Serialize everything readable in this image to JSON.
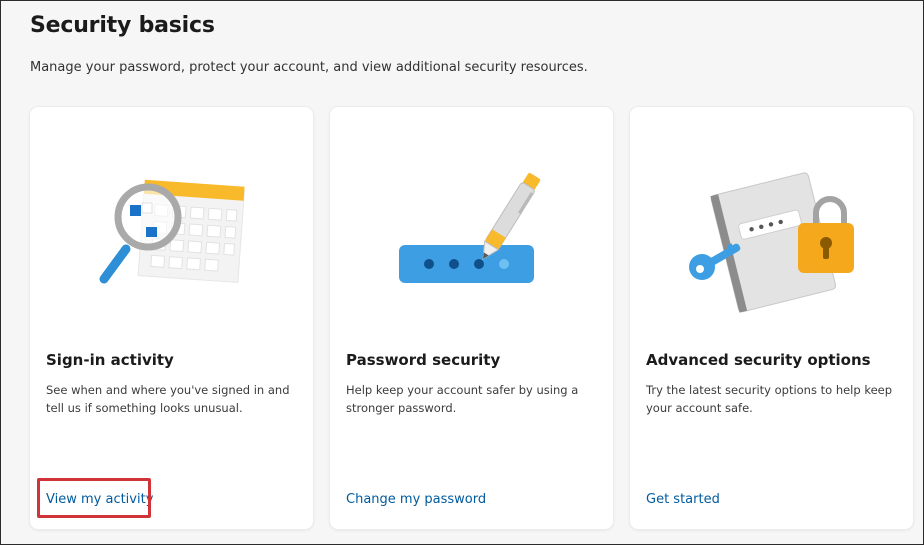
{
  "page": {
    "title": "Security basics",
    "subtitle": "Manage your password, protect your account, and view additional security resources."
  },
  "cards": [
    {
      "icon": "magnifier-calendar-icon",
      "title": "Sign-in activity",
      "description": "See when and where you've signed in and tell us if something looks unusual.",
      "link": "View my activity",
      "highlighted": true
    },
    {
      "icon": "password-pen-icon",
      "title": "Password security",
      "description": "Help keep your account safer by using a stronger password.",
      "link": "Change my password",
      "highlighted": false
    },
    {
      "icon": "lock-key-book-icon",
      "title": "Advanced security options",
      "description": "Try the latest security options to help keep your account safe.",
      "link": "Get started",
      "highlighted": false
    }
  ],
  "colors": {
    "link": "#005a9e",
    "highlight": "#d13438",
    "accent_yellow": "#f8b92a",
    "accent_blue": "#2e8fd6"
  }
}
